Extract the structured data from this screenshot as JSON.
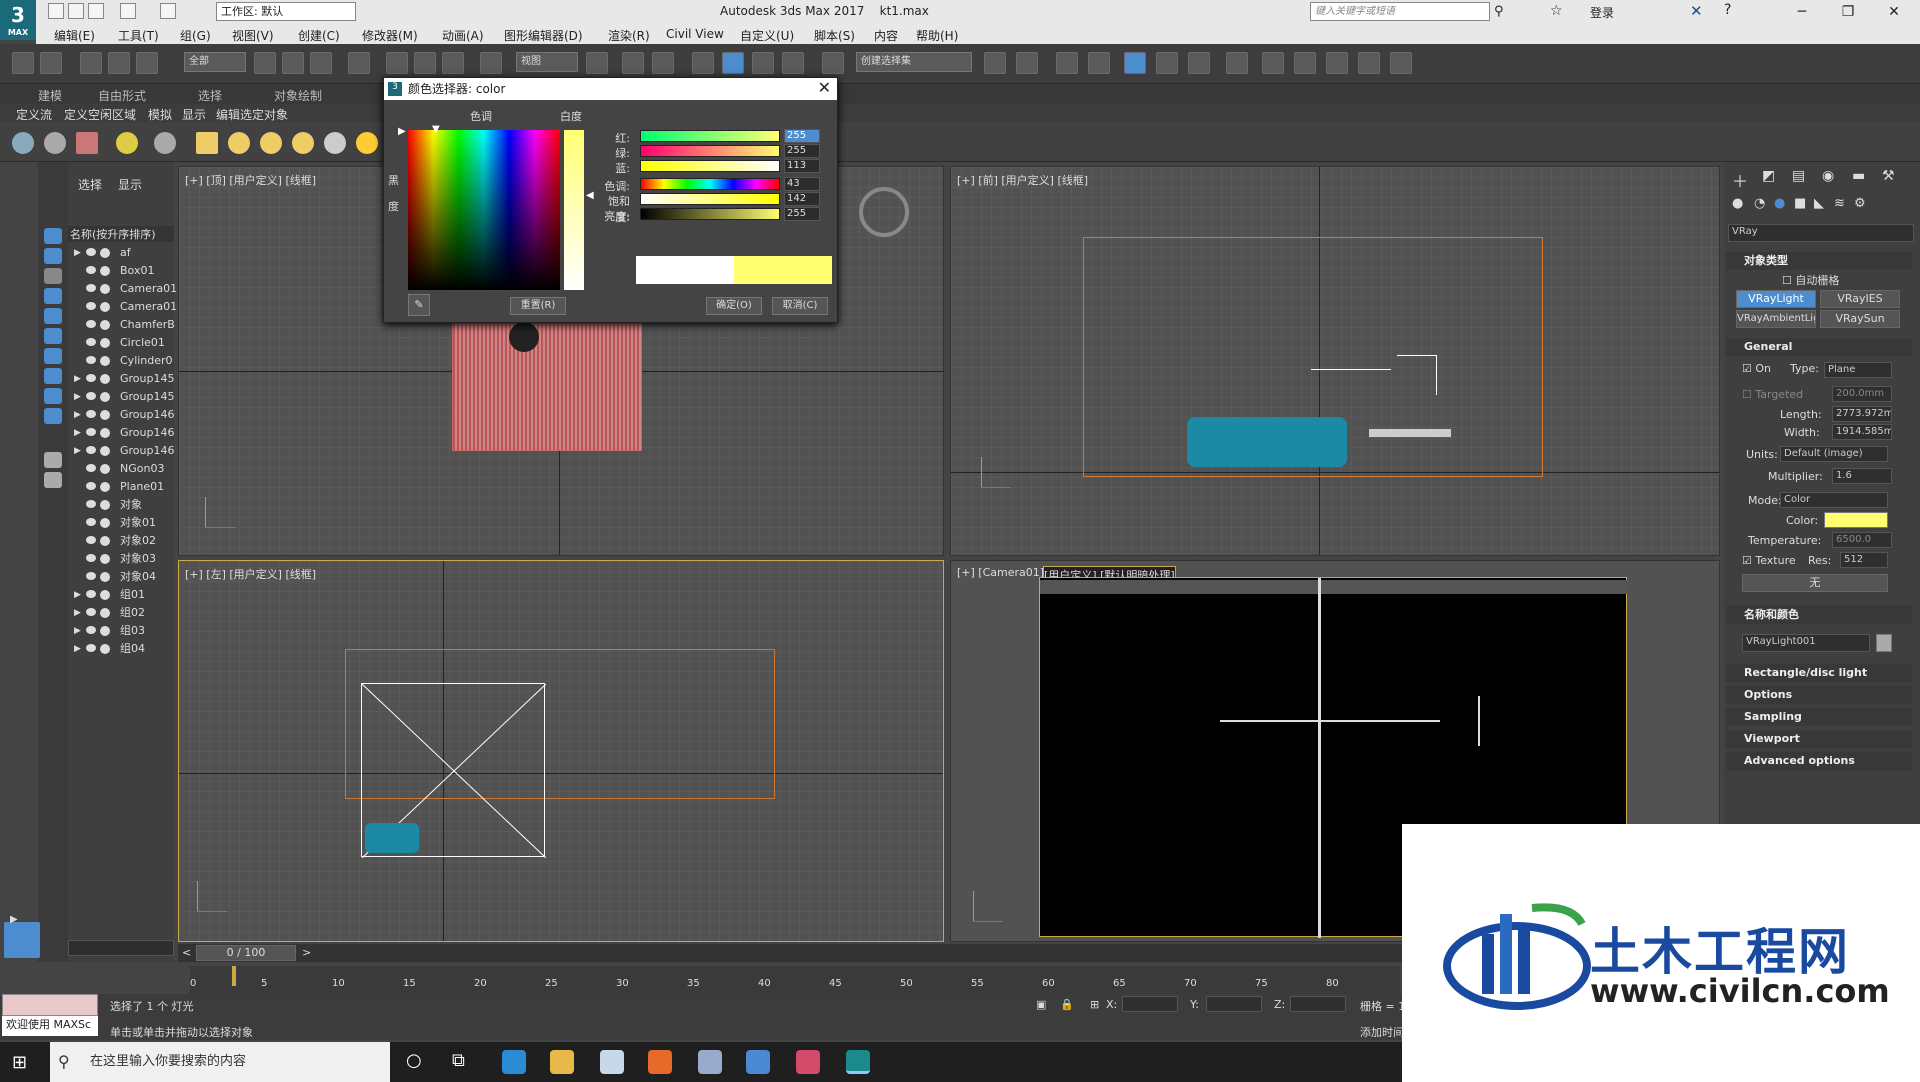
{
  "titlebar": {
    "workspace": "工作区: 默认",
    "app": "Autodesk 3ds Max 2017",
    "file": "kt1.max",
    "search_placeholder": "键入关键字或短语",
    "login": "登录",
    "logo": "3",
    "logo_sub": "MAX"
  },
  "menu": [
    "编辑(E)",
    "工具(T)",
    "组(G)",
    "视图(V)",
    "创建(C)",
    "修改器(M)",
    "动画(A)",
    "图形编辑器(D)",
    "渲染(R)",
    "Civil View",
    "自定义(U)",
    "脚本(S)",
    "内容",
    "帮助(H)"
  ],
  "toolbar": {
    "filter": "全部",
    "ref": "视图",
    "selset": "创建选择集"
  },
  "ribbon": {
    "tabs": [
      "建模",
      "自由形式",
      "选择",
      "对象绘制"
    ],
    "subtabs": [
      "定义流",
      "定义空闲区域",
      "模拟",
      "显示",
      "编辑选定对象"
    ]
  },
  "explorer": {
    "tabs": [
      "选择",
      "显示"
    ],
    "header": "名称(按升序排序)",
    "rows": [
      {
        "n": "af",
        "g": true
      },
      {
        "n": "Box01",
        "g": false
      },
      {
        "n": "Camera01",
        "g": false
      },
      {
        "n": "Camera01",
        "g": false
      },
      {
        "n": "ChamferB",
        "g": false
      },
      {
        "n": "Circle01",
        "g": false
      },
      {
        "n": "Cylinder0",
        "g": false
      },
      {
        "n": "Group145",
        "g": true
      },
      {
        "n": "Group145",
        "g": true
      },
      {
        "n": "Group146",
        "g": true
      },
      {
        "n": "Group146",
        "g": true
      },
      {
        "n": "Group146",
        "g": true
      },
      {
        "n": "NGon03",
        "g": false
      },
      {
        "n": "Plane01",
        "g": false
      },
      {
        "n": "对象",
        "g": false
      },
      {
        "n": "对象01",
        "g": false
      },
      {
        "n": "对象02",
        "g": false
      },
      {
        "n": "对象03",
        "g": false
      },
      {
        "n": "对象04",
        "g": false
      },
      {
        "n": "组01",
        "g": true
      },
      {
        "n": "组02",
        "g": true
      },
      {
        "n": "组03",
        "g": true
      },
      {
        "n": "组04",
        "g": true
      }
    ]
  },
  "viewports": {
    "top": "[+] [顶] [用户定义] [线框]",
    "front": "[+] [前] [用户定义] [线框]",
    "left": "[+] [左] [用户定义] [线框]",
    "camera_a": "[+] [Camera01]",
    "camera_b": "[用户定义] [默认明暗处理]"
  },
  "color_dialog": {
    "title": "颜色选择器: color",
    "hue_label": "色调",
    "white_label": "白度",
    "black_label": "黑",
    "deg_label": "度",
    "sliders": [
      {
        "label": "红:",
        "value": "255",
        "bg": "linear-gradient(to right,#00ff71,#ffff71)"
      },
      {
        "label": "绿:",
        "value": "255",
        "bg": "linear-gradient(to right,#ff0071,#ffff71)"
      },
      {
        "label": "蓝:",
        "value": "113",
        "bg": "linear-gradient(to right,#ffff00,#ffffff)"
      },
      {
        "label": "色调:",
        "value": "43",
        "bg": "linear-gradient(to right,#f00,#ff0,#0f0,#0ff,#00f,#f0f,#f00)"
      },
      {
        "label": "饱和度:",
        "value": "142",
        "bg": "linear-gradient(to right,#fff,#ffff00)"
      },
      {
        "label": "亮度:",
        "value": "255",
        "bg": "linear-gradient(to right,#000,#ffff71)"
      }
    ],
    "reset": "重置(R)",
    "ok": "确定(O)",
    "cancel": "取消(C)"
  },
  "command_panel": {
    "renderer": "VRay",
    "obj_type": "对象类型",
    "auto_grid": "自动栅格",
    "buttons": [
      "VRayLight",
      "VRayIES",
      "VRayAmbientLigh",
      "VRaySun"
    ],
    "general": "General",
    "on": "On",
    "type_label": "Type:",
    "type": "Plane",
    "targeted": "Targeted",
    "targeted_val": "200.0mm",
    "length_label": "Length:",
    "length": "2773.972m",
    "width_label": "Width:",
    "width": "1914.585m",
    "units_label": "Units:",
    "units": "Default (image)",
    "mult_label": "Multiplier:",
    "mult": "1.6",
    "mode_label": "Mode:",
    "mode": "Color",
    "color_label": "Color:",
    "color": "#ffff71",
    "temp_label": "Temperature:",
    "temp": "6500.0",
    "texture": "Texture",
    "res_label": "Res:",
    "res": "512",
    "none": "无",
    "name_color": "名称和颜色",
    "objname": "VRayLight001",
    "sections": [
      "Rectangle/disc light",
      "Options",
      "Sampling",
      "Viewport",
      "Advanced options"
    ]
  },
  "timeline": {
    "frame": "0 / 100",
    "ticks": [
      "0",
      "5",
      "10",
      "15",
      "20",
      "25",
      "30",
      "35",
      "40",
      "45",
      "50",
      "55",
      "60",
      "65",
      "70",
      "75",
      "80"
    ]
  },
  "status": {
    "welcome": "欢迎使用 MAXSc",
    "selected": "选择了 1 个 灯光",
    "hint": "单击或单击并拖动以选择对象",
    "x": "X:",
    "y": "Y:",
    "z": "Z:",
    "grid": "栅格 = 1",
    "addtime": "添加时间"
  },
  "taskbar": {
    "search": "在这里输入你要搜索的内容"
  },
  "watermark": {
    "title": "土木工程网",
    "url": "www.civilcn.com"
  }
}
